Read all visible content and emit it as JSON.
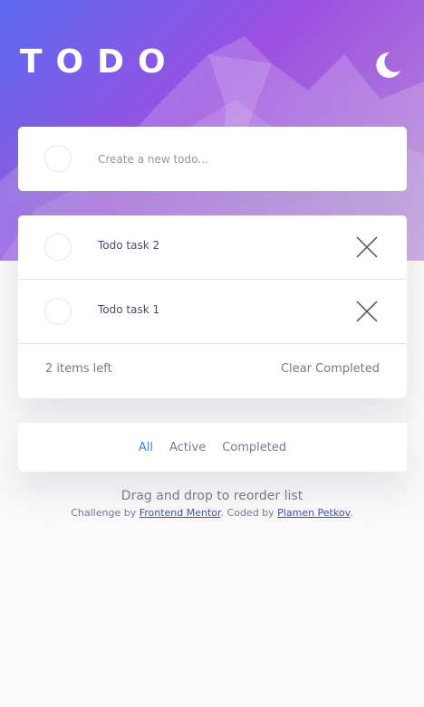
{
  "header": {
    "title": "TODO",
    "theme_icon": "moon-icon"
  },
  "create": {
    "placeholder": "Create a new todo..."
  },
  "todos": [
    {
      "text": "Todo task 2",
      "completed": false
    },
    {
      "text": "Todo task 1",
      "completed": false
    }
  ],
  "footer": {
    "items_left": "2 items left",
    "clear_label": "Clear Completed"
  },
  "filters": {
    "all": "All",
    "active": "Active",
    "completed": "Completed",
    "selected": "All"
  },
  "hint": "Drag and drop to reorder list",
  "attribution": {
    "prefix": "Challenge by ",
    "link1": "Frontend Mentor",
    "middle": ". Coded by ",
    "link2": "Plamen Petkov",
    "suffix": "."
  },
  "colors": {
    "accent": "#3a7cfd",
    "text": "#494c6b",
    "muted": "#77798f"
  }
}
